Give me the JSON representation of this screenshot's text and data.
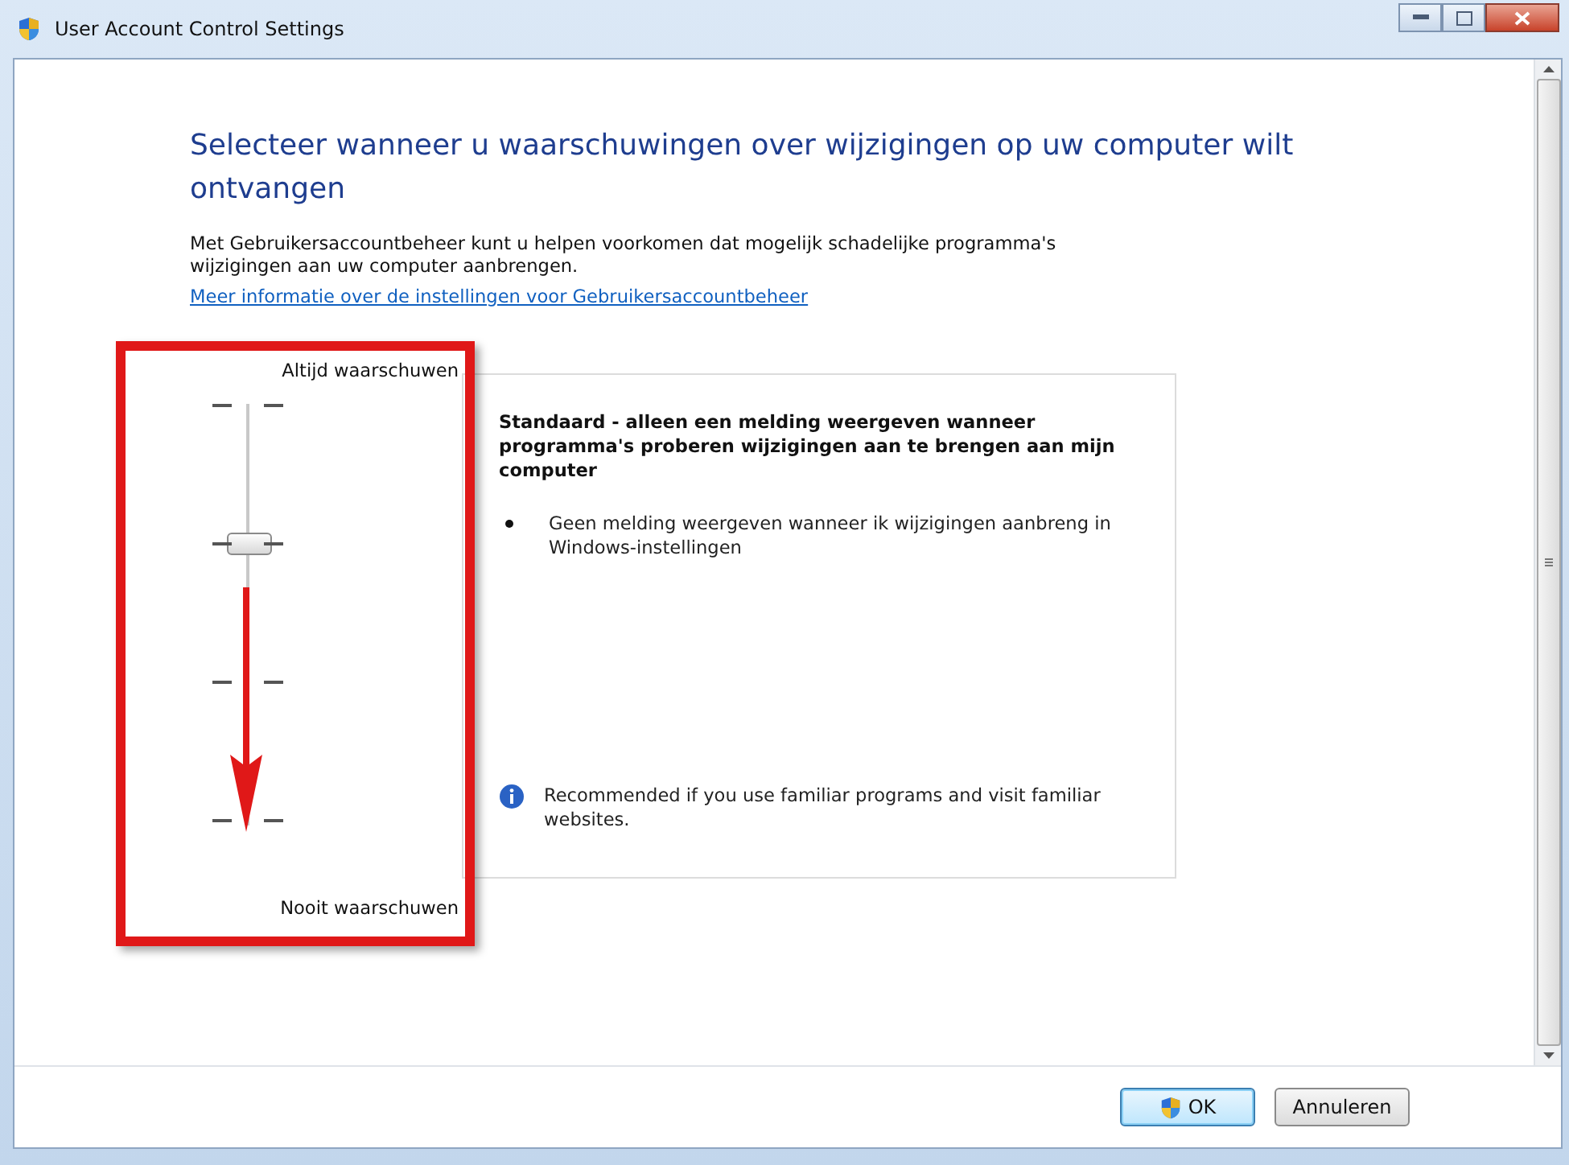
{
  "window": {
    "title": "User Account Control Settings"
  },
  "heading": "Selecteer wanneer u waarschuwingen over wijzigingen op uw computer wilt ontvangen",
  "intro": "Met Gebruikersaccountbeheer kunt u helpen voorkomen dat mogelijk schadelijke programma's wijzigingen aan uw computer aanbrengen.",
  "link": "Meer informatie over de instellingen voor Gebruikersaccountbeheer",
  "slider": {
    "top_label": "Altijd waarschuwen",
    "bottom_label": "Nooit waarschuwen",
    "level": 0.67
  },
  "details": {
    "title": "Standaard - alleen een melding weergeven wanneer programma's proberen wijzigingen aan te brengen aan mijn computer",
    "bullets": [
      "Geen melding weergeven wanneer ik wijzigingen aanbreng in Windows-instellingen"
    ],
    "recommendation": "Recommended if you use familiar programs and visit familiar websites."
  },
  "buttons": [
    {
      "label": "OK",
      "kind": "shield",
      "focused": true
    },
    {
      "label": "Annuleren",
      "kind": "plain",
      "focused": false
    }
  ]
}
